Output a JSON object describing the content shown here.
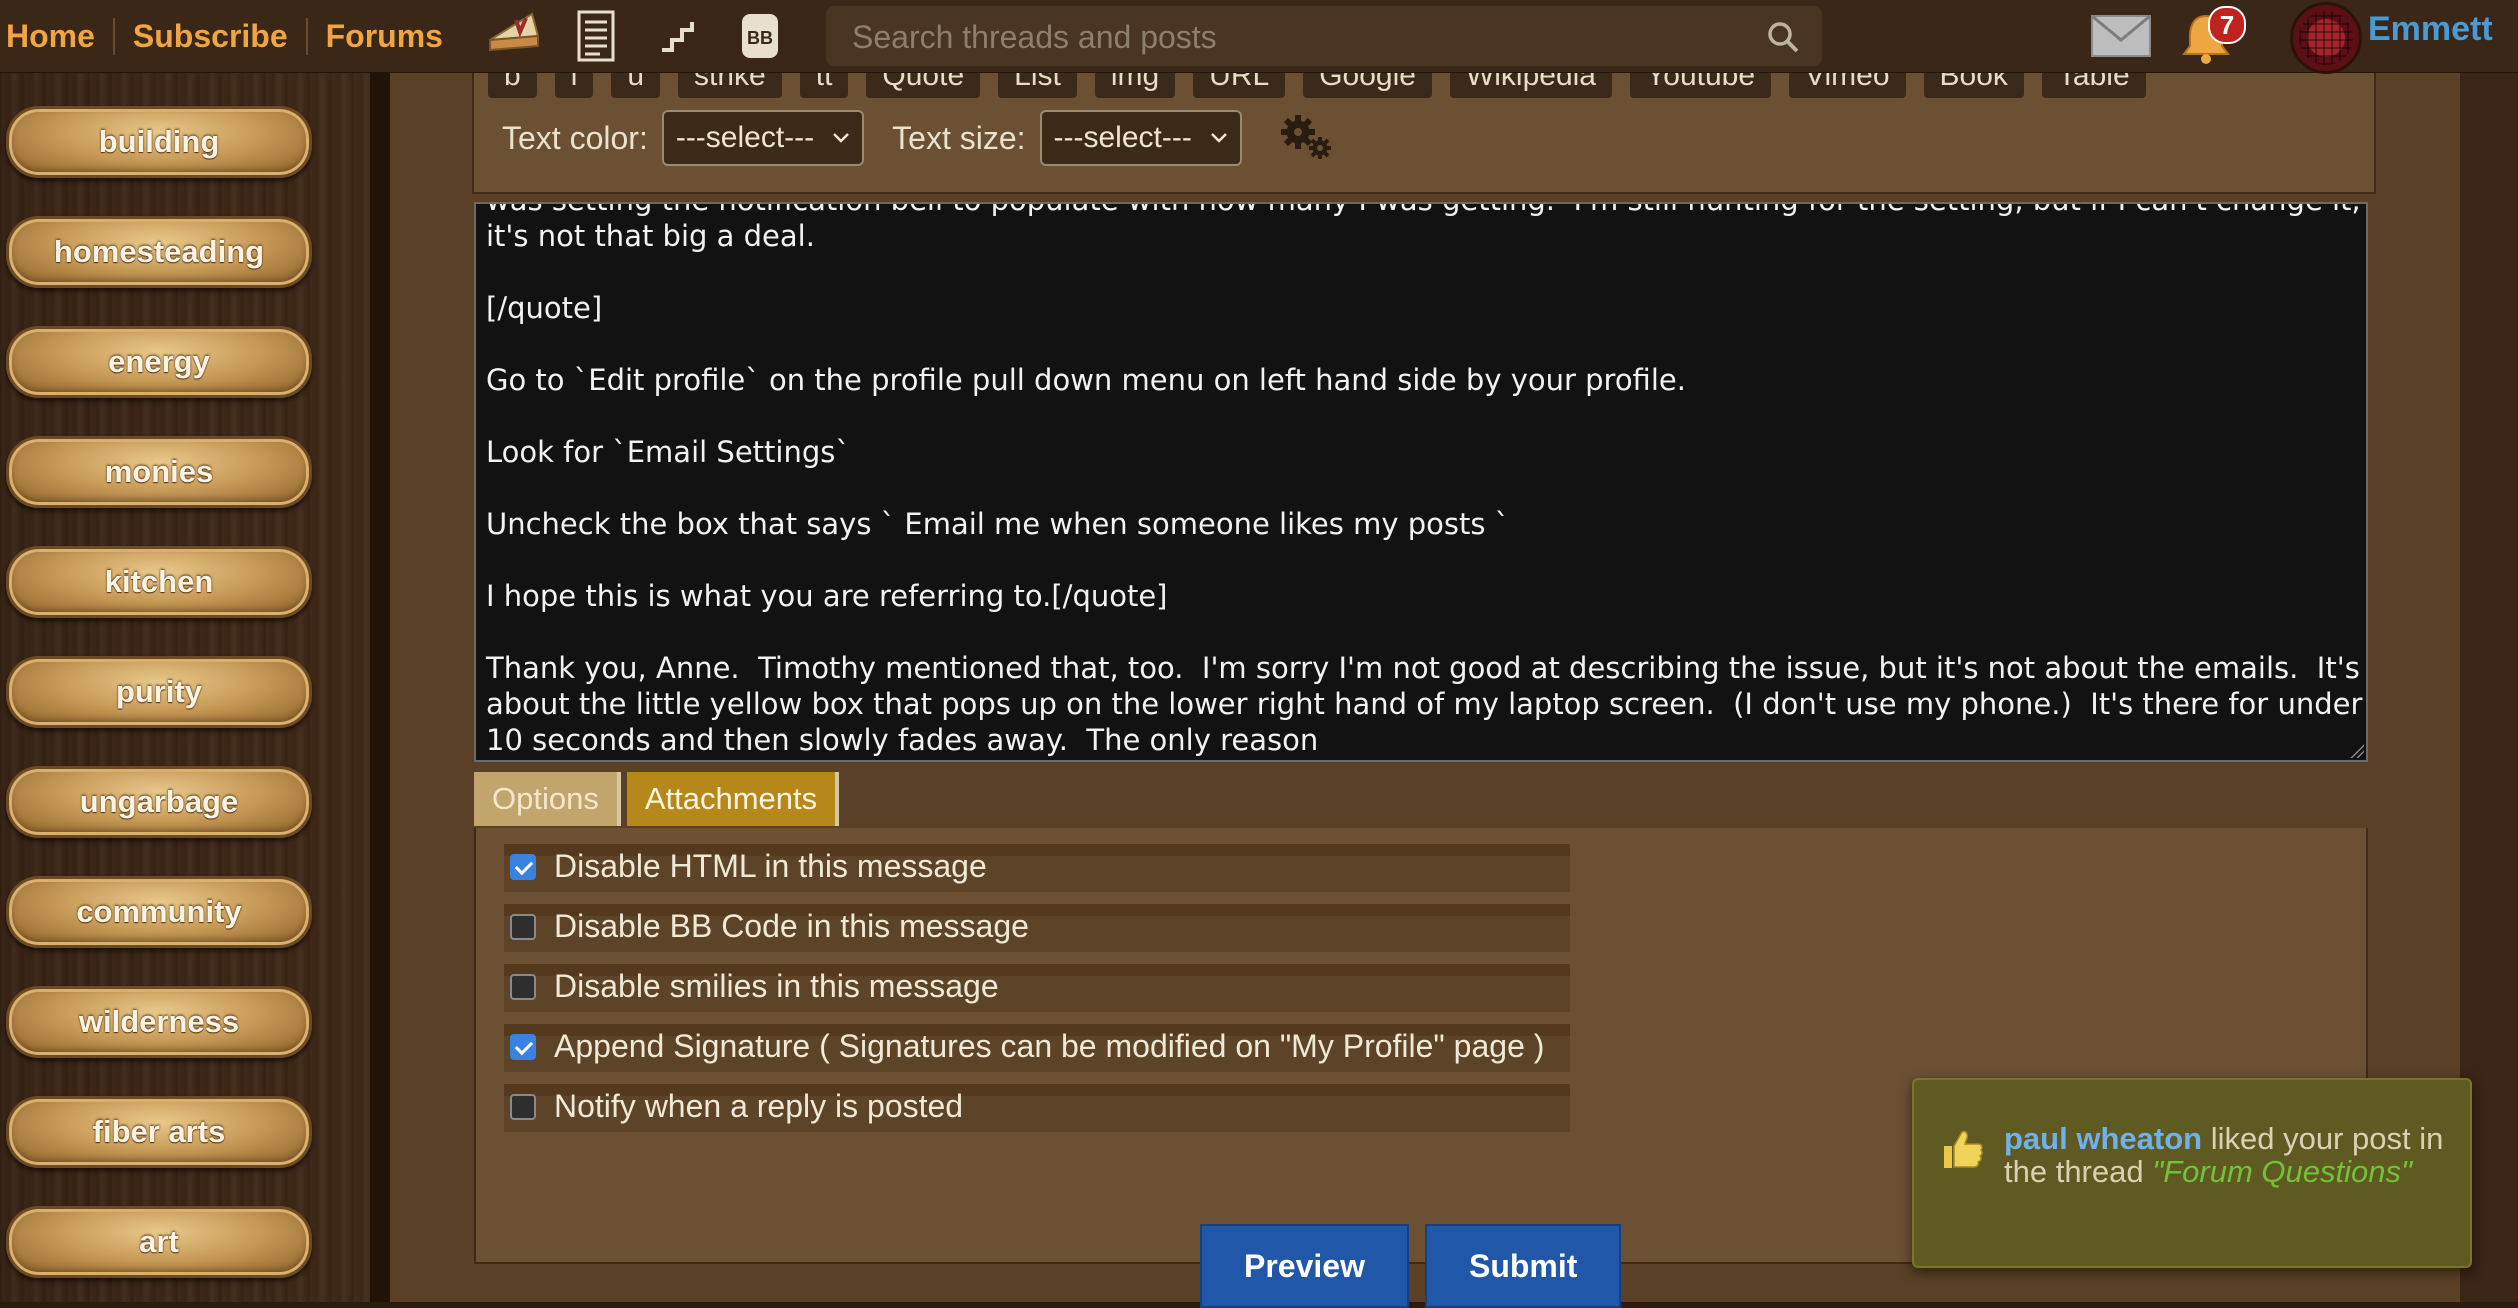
{
  "nav": {
    "home": "Home",
    "subscribe": "Subscribe",
    "forums": "Forums"
  },
  "search": {
    "placeholder": "Search threads and posts"
  },
  "notifications": {
    "count": "7"
  },
  "user": {
    "name": "Emmett"
  },
  "sidebar": {
    "items": [
      {
        "label": "building"
      },
      {
        "label": "homesteading"
      },
      {
        "label": "energy"
      },
      {
        "label": "monies"
      },
      {
        "label": "kitchen"
      },
      {
        "label": "purity"
      },
      {
        "label": "ungarbage"
      },
      {
        "label": "community"
      },
      {
        "label": "wilderness"
      },
      {
        "label": "fiber arts"
      },
      {
        "label": "art"
      }
    ]
  },
  "editor": {
    "toolbar": [
      "b",
      "i",
      "u",
      "strike",
      "tt",
      "Quote",
      "List",
      "img",
      "URL",
      "Google",
      "Wikipedia",
      "Youtube",
      "Vimeo",
      "Book",
      "Table"
    ],
    "text_color_label": "Text color:",
    "text_color_value": "---select---",
    "text_size_label": "Text size:",
    "text_size_value": "---select---",
    "lines": [
      "was setting the notification bell to populate with how many I was getting.  I'm still hunting for the setting, but if I can't change it,",
      "it's not that big a deal.",
      "",
      "[/quote]",
      "",
      "Go to `Edit profile` on the profile pull down menu on left hand side by your profile.",
      "",
      "Look for `Email Settings`",
      "",
      "Uncheck the box that says ` Email me when someone likes my posts `",
      "",
      "I hope this is what you are referring to.[/quote]",
      "",
      "Thank you, Anne.  Timothy mentioned that, too.  I'm sorry I'm not good at describing the issue, but it's not about the emails.  It's",
      "about the little yellow box that pops up on the lower right hand of my laptop screen.  (I don't use my phone.)  It's there for under",
      "10 seconds and then slowly fades away.  The only reason"
    ]
  },
  "tabs": {
    "options": "Options",
    "attachments": "Attachments"
  },
  "options": [
    {
      "label": "Disable HTML in this message",
      "checked": true
    },
    {
      "label": "Disable BB Code in this message",
      "checked": false
    },
    {
      "label": "Disable smilies in this message",
      "checked": false
    },
    {
      "label": "Append Signature ( Signatures can be modified on \"My Profile\" page )",
      "checked": true
    },
    {
      "label": "Notify when a reply is posted",
      "checked": false
    }
  ],
  "buttons": {
    "preview": "Preview",
    "submit": "Submit"
  },
  "toast": {
    "who": "paul wheaton",
    "text": "liked your post in the thread",
    "thread": "\"Forum Questions\""
  }
}
